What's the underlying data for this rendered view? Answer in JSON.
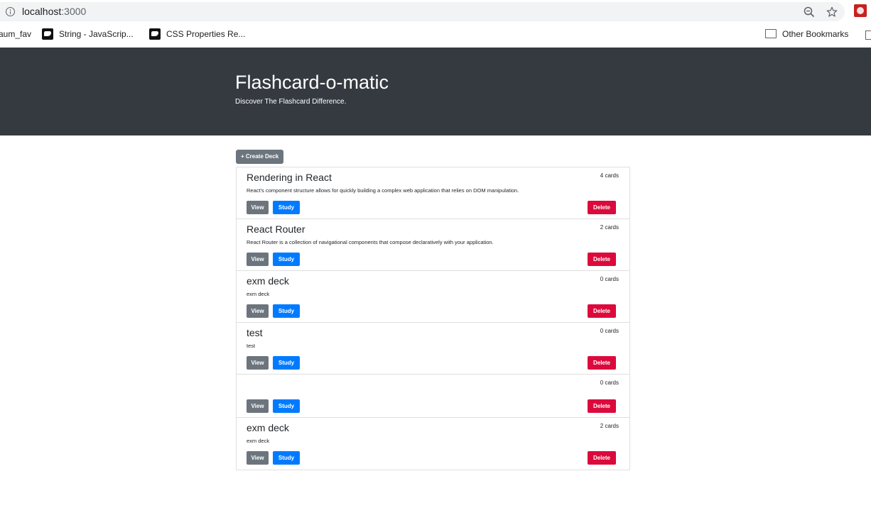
{
  "browser": {
    "url_host": "localhost",
    "url_port": ":3000",
    "bookmarks": [
      {
        "label": "aum_fav"
      },
      {
        "label": "String - JavaScrip..."
      },
      {
        "label": "CSS Properties Re..."
      }
    ],
    "other_bookmarks": "Other Bookmarks"
  },
  "header": {
    "title": "Flashcard-o-matic",
    "subtitle": "Discover The Flashcard Difference."
  },
  "actions": {
    "create_deck": "+ Create Deck"
  },
  "buttons": {
    "view": "View",
    "study": "Study",
    "delete": "Delete"
  },
  "colors": {
    "jumbotron": "#343a40",
    "secondary": "#6c757d",
    "primary": "#007bff",
    "danger": "#dc0a3c"
  },
  "decks": [
    {
      "name": "Rendering in React",
      "count": "4 cards",
      "description": "React's component structure allows for quickly building a complex web application that relies on DOM manipulation."
    },
    {
      "name": "React Router",
      "count": "2 cards",
      "description": "React Router is a collection of navigational components that compose declaratively with your application."
    },
    {
      "name": "exm deck",
      "count": "0 cards",
      "description": "exm deck"
    },
    {
      "name": "test",
      "count": "0 cards",
      "description": "test"
    },
    {
      "name": "",
      "count": "0 cards",
      "description": ""
    },
    {
      "name": "exm deck",
      "count": "2 cards",
      "description": "exm deck"
    }
  ]
}
